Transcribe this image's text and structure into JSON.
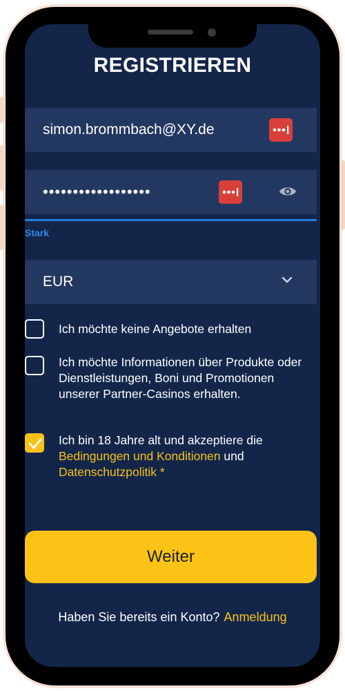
{
  "header": {
    "title": "REGISTRIEREN"
  },
  "form": {
    "email": {
      "value": "simon.brommbach@XY.de"
    },
    "password": {
      "masked_value": "••••••••••••••••••",
      "strength_label": "Stark",
      "strength_color": "#1f7fdc"
    },
    "currency": {
      "selected": "EUR"
    },
    "checkboxes": [
      {
        "label": "Ich möchte keine Angebote erhalten",
        "checked": false
      },
      {
        "label": "Ich möchte Informationen über Produkte oder Dienstleistungen, Boni und Promotionen unserer Partner-Casinos erhalten.",
        "checked": false
      },
      {
        "label_prefix": "Ich bin 18 Jahre alt und akzeptiere die",
        "terms_link": "Bedingungen und Konditionen",
        "connector": "und",
        "privacy_link": "Datenschutzpolitik",
        "required_mark": "*",
        "checked": true
      }
    ],
    "submit_label": "Weiter"
  },
  "footer": {
    "prompt": "Haben Sie bereits ein Konto?",
    "login_link": "Anmeldung"
  },
  "icons": {
    "password_manager": "password-manager-icon",
    "visibility": "eye-icon",
    "dropdown": "chevron-down-icon",
    "checked": "checkmark-icon"
  },
  "colors": {
    "background": "#13264a",
    "field": "#233861",
    "accent": "#fcc316",
    "link": "#f7c21a",
    "password_manager": "#d9403a"
  }
}
